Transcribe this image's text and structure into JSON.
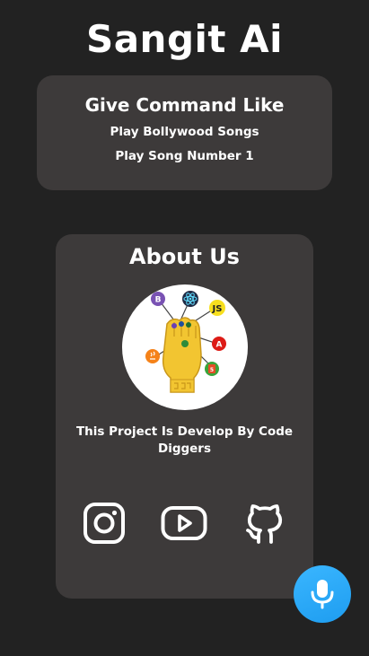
{
  "app": {
    "title": "Sangit Ai"
  },
  "commands": {
    "heading": "Give Command Like",
    "examples": [
      "Play Bollywood Songs",
      "Play Song Number 1"
    ]
  },
  "about": {
    "heading": "About Us",
    "description": "This Project Is Develop By Code Diggers",
    "logo_icons": [
      "bootstrap-icon",
      "react-icon",
      "js-icon",
      "angular-icon",
      "html5-icon",
      "java-icon"
    ]
  },
  "social_links": [
    {
      "icon": "instagram-icon"
    },
    {
      "icon": "youtube-icon"
    },
    {
      "icon": "github-icon"
    }
  ],
  "mic": {
    "icon": "microphone-icon"
  },
  "colors": {
    "background": "#222222",
    "card": "#3d3a3a",
    "text": "#ffffff",
    "mic_button": "#2aa8f7"
  }
}
